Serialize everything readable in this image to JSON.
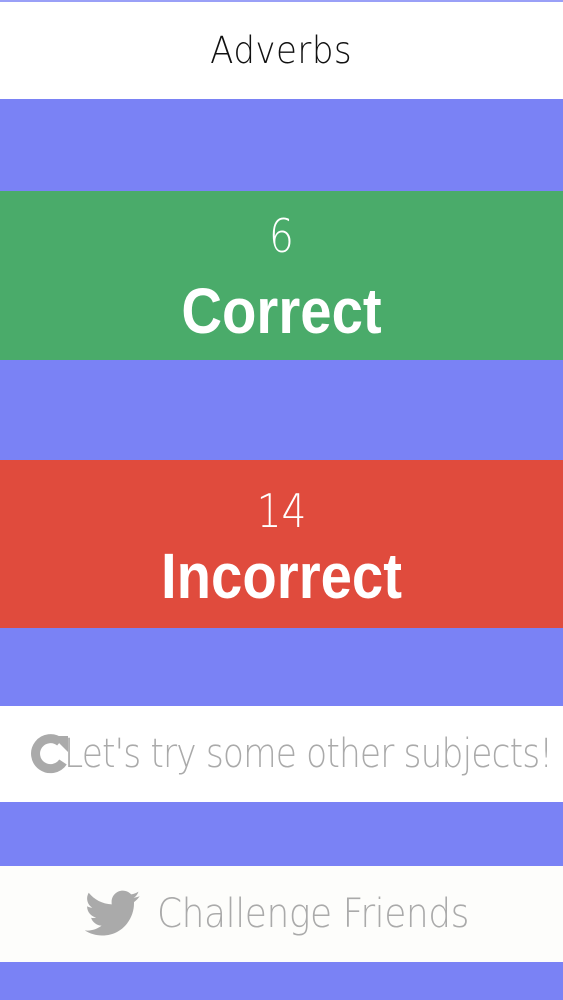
{
  "header": {
    "title": "Adverbs"
  },
  "results": {
    "correct": {
      "count": "6",
      "label": "Correct",
      "color": "#4aab6a"
    },
    "incorrect": {
      "count": "14",
      "label": "Incorrect",
      "color": "#e04b3d"
    }
  },
  "actions": {
    "try_other_subjects": {
      "label": "Let's try some other subjects!",
      "icon": "refresh-icon"
    },
    "challenge_friends": {
      "label": "Challenge Friends",
      "icon": "twitter-bird-icon"
    }
  },
  "colors": {
    "background": "#7a82f5",
    "button_text": "#aaaaaa"
  }
}
